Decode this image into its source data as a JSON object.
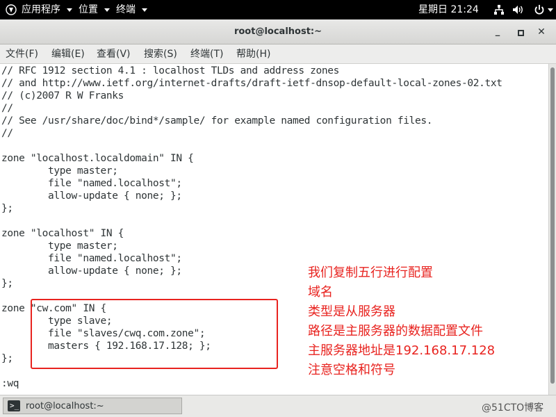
{
  "topbar": {
    "apps": "应用程序",
    "places": "位置",
    "terminal": "终端",
    "clock": "星期日 21:24"
  },
  "window": {
    "title": "root@localhost:~"
  },
  "menubar": {
    "file": "文件(F)",
    "edit": "编辑(E)",
    "view": "查看(V)",
    "search": "搜索(S)",
    "terminal": "终端(T)",
    "help": "帮助(H)"
  },
  "terminal": {
    "lines": [
      "// RFC 1912 section 4.1 : localhost TLDs and address zones",
      "// and http://www.ietf.org/internet-drafts/draft-ietf-dnsop-default-local-zones-02.txt",
      "// (c)2007 R W Franks",
      "//",
      "// See /usr/share/doc/bind*/sample/ for example named configuration files.",
      "//",
      "",
      "zone \"localhost.localdomain\" IN {",
      "        type master;",
      "        file \"named.localhost\";",
      "        allow-update { none; };",
      "};",
      "",
      "zone \"localhost\" IN {",
      "        type master;",
      "        file \"named.localhost\";",
      "        allow-update { none; };",
      "};",
      "",
      "zone \"cw.com\" IN {",
      "        type slave;",
      "        file \"slaves/cwq.com.zone\";",
      "        masters { 192.168.17.128; };",
      "",
      "};",
      "",
      ":wq"
    ]
  },
  "annotation": {
    "notes": [
      "我们复制五行进行配置",
      "域名",
      "类型是从服务器",
      "路径是主服务器的数据配置文件",
      "主服务器地址是192.168.17.128",
      "注意空格和符号"
    ],
    "color": "#e8231f"
  },
  "taskbar": {
    "item_label": "root@localhost:~",
    "watermark": "@51CTO博客"
  }
}
